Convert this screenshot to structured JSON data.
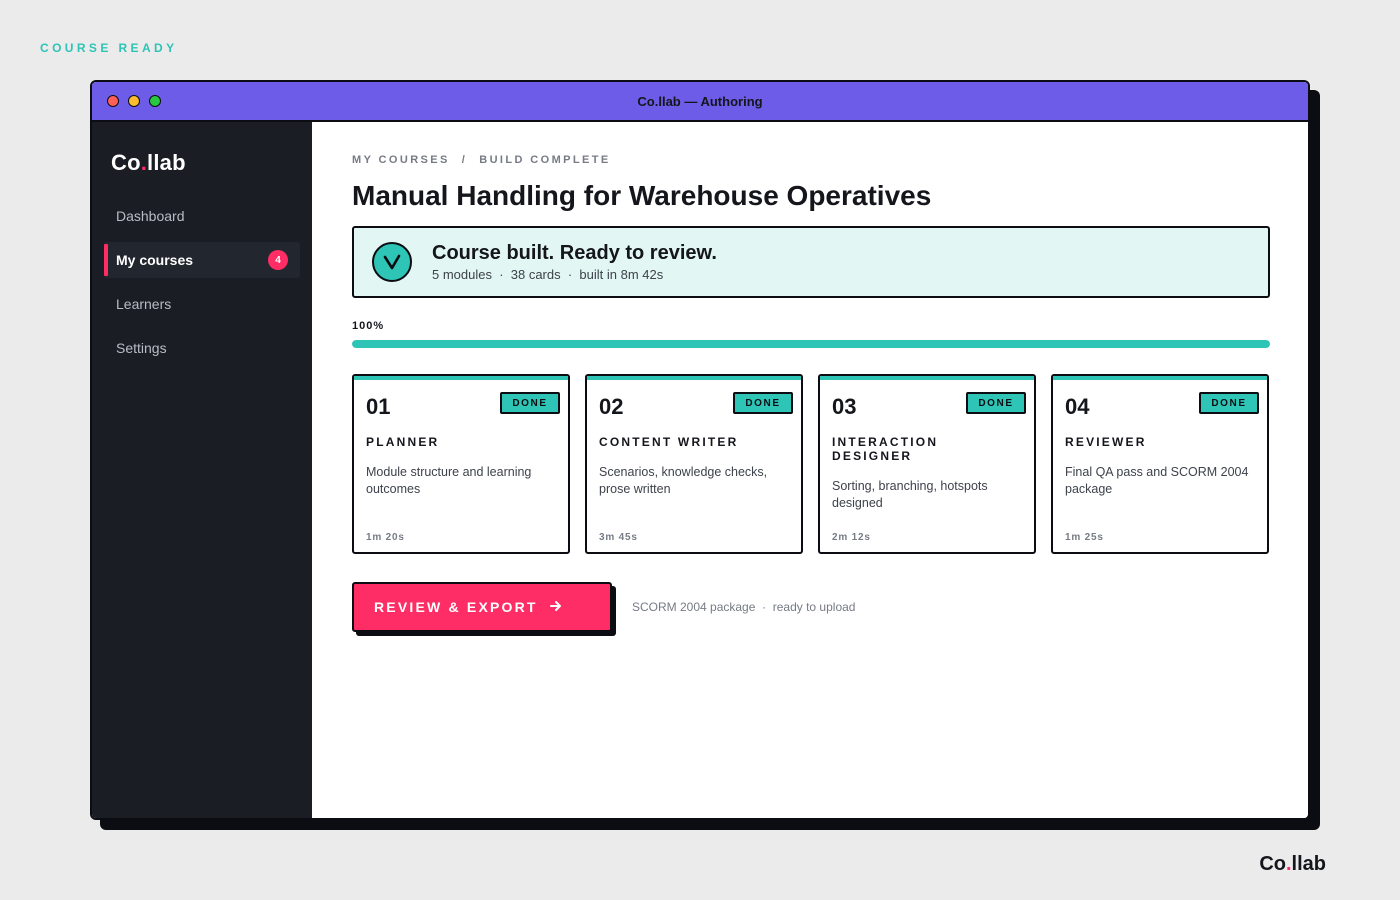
{
  "page_tag": "COURSE READY",
  "window": {
    "title": "Co.llab — Authoring",
    "dots": [
      "#ff5f57",
      "#febc2e",
      "#28c840"
    ]
  },
  "brand": {
    "prefix": "Co",
    "dot": ".",
    "suffix": "llab"
  },
  "sidebar": {
    "items": [
      {
        "label": "Dashboard",
        "active": false
      },
      {
        "label": "My courses",
        "active": true,
        "badge": "4"
      },
      {
        "label": "Learners",
        "active": false
      },
      {
        "label": "Settings",
        "active": false
      }
    ]
  },
  "main": {
    "breadcrumb": {
      "parent": "MY COURSES",
      "separator": "/",
      "current": "BUILD COMPLETE"
    },
    "title": "Manual Handling for Warehouse Operatives",
    "banner": {
      "icon": "check-icon",
      "title": "Course built. Ready to review.",
      "subtitle": "5 modules  ·  38 cards  ·  built in 8m 42s"
    },
    "progress": {
      "label": "100%",
      "value": 1.0
    },
    "cards": [
      {
        "num": "01",
        "status": "DONE",
        "role": "PLANNER",
        "desc": "Module structure and learning outcomes",
        "time": "1m 20s"
      },
      {
        "num": "02",
        "status": "DONE",
        "role": "CONTENT WRITER",
        "desc": "Scenarios, knowledge checks, prose written",
        "time": "3m 45s"
      },
      {
        "num": "03",
        "status": "DONE",
        "role": "INTERACTION DESIGNER",
        "desc": "Sorting, branching, hotspots designed",
        "time": "2m 12s"
      },
      {
        "num": "04",
        "status": "DONE",
        "role": "REVIEWER",
        "desc": "Final QA pass and SCORM 2004 package",
        "time": "1m 25s"
      }
    ],
    "action": {
      "button_label": "REVIEW & EXPORT",
      "button_icon": "arrow-right-icon",
      "note": "SCORM 2004 package  ·  ready to upload"
    }
  },
  "colors": {
    "accent_teal": "#2ec4b6",
    "accent_pink": "#ff2d66",
    "titlebar_purple": "#6c5ce7",
    "sidebar_dark": "#1a1d24"
  }
}
